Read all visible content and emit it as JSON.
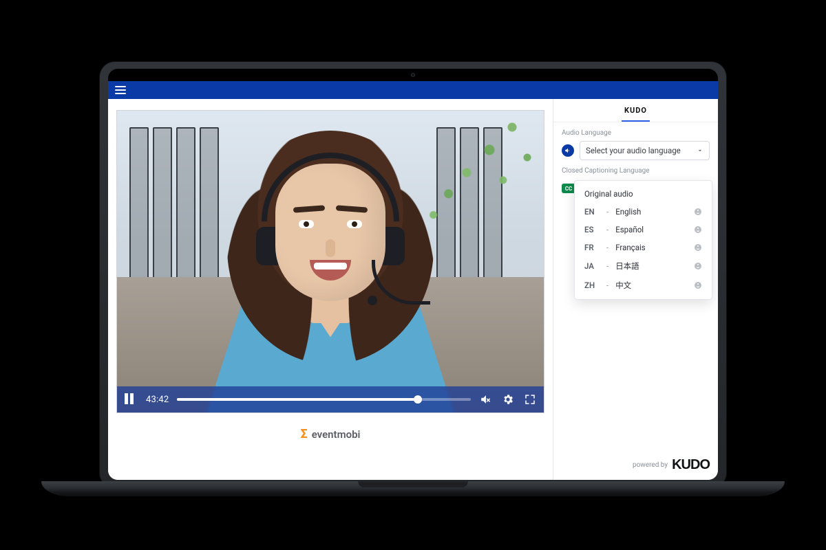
{
  "header": {
    "menu_aria": "menu"
  },
  "video": {
    "time": "43:42",
    "progress_pct": 82
  },
  "brand": {
    "name": "eventmobi"
  },
  "panel": {
    "tab": "KUDO",
    "audio_label": "Audio Language",
    "audio_placeholder": "Select your audio language",
    "captions_label": "Closed Captioning Language",
    "cc_badge": "CC",
    "options": [
      {
        "code": "",
        "name": "Original audio"
      },
      {
        "code": "EN",
        "name": "English"
      },
      {
        "code": "ES",
        "name": "Español"
      },
      {
        "code": "FR",
        "name": "Français"
      },
      {
        "code": "JA",
        "name": "日本語"
      },
      {
        "code": "ZH",
        "name": "中文"
      }
    ]
  },
  "footer": {
    "powered_by": "powered by",
    "brand": "KUDO"
  }
}
